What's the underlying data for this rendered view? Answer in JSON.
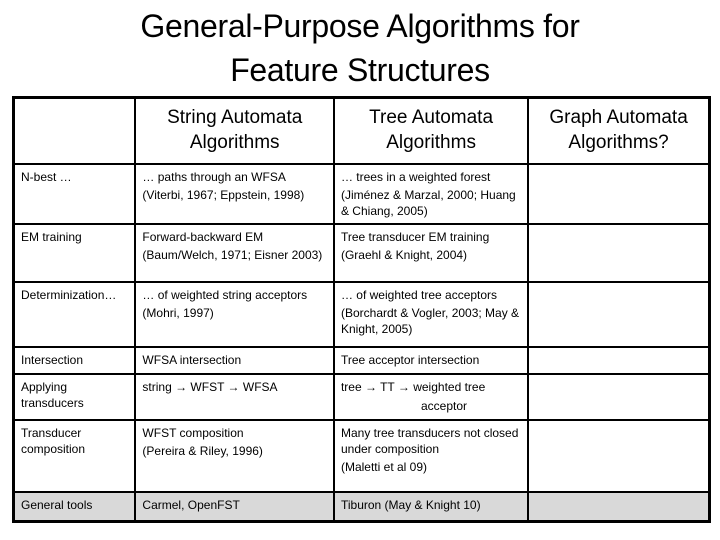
{
  "slide": {
    "title_line1": "General-Purpose Algorithms for",
    "title_line2": "Feature Structures"
  },
  "table": {
    "headers": [
      "",
      "String Automata Algorithms",
      "Tree Automata Algorithms",
      "Graph Automata Algorithms?"
    ],
    "rows": [
      {
        "label": "N-best …",
        "string": {
          "main": "… paths through an WFSA",
          "cite": "(Viterbi, 1967; Eppstein, 1998)"
        },
        "tree": {
          "main": "… trees in a weighted forest",
          "cite": "(Jiménez & Marzal, 2000; Huang & Chiang, 2005)"
        },
        "graph": ""
      },
      {
        "label": "EM training",
        "string": {
          "main": "Forward-backward EM",
          "cite": "(Baum/Welch, 1971; Eisner 2003)"
        },
        "tree": {
          "main": "Tree transducer EM training",
          "cite": "(Graehl & Knight, 2004)"
        },
        "graph": ""
      },
      {
        "label": "Determinization…",
        "string": {
          "main": "… of weighted string acceptors",
          "cite": "(Mohri, 1997)"
        },
        "tree": {
          "main": "… of weighted tree acceptors",
          "cite": "(Borchardt & Vogler, 2003; May & Knight, 2005)"
        },
        "graph": ""
      },
      {
        "label": "Intersection",
        "string": {
          "main": "WFSA intersection",
          "cite": ""
        },
        "tree": {
          "main": "Tree acceptor intersection",
          "cite": ""
        },
        "graph": ""
      },
      {
        "label": "Applying transducers",
        "string": {
          "main": "string → WFST → WFSA",
          "cite": ""
        },
        "tree": {
          "main": "tree → TT → weighted tree",
          "cite": "acceptor"
        },
        "graph": ""
      },
      {
        "label": "Transducer composition",
        "string": {
          "main": "WFST composition",
          "cite": "(Pereira & Riley, 1996)"
        },
        "tree": {
          "main": "Many tree transducers not closed under composition",
          "cite": "(Maletti et al 09)"
        },
        "graph": ""
      },
      {
        "label": "General tools",
        "string": {
          "main": "Carmel, OpenFST",
          "cite": ""
        },
        "tree": {
          "main": "Tiburon (May & Knight 10)",
          "cite": ""
        },
        "graph": ""
      }
    ],
    "last_row_bg": "#d9d9d9"
  }
}
